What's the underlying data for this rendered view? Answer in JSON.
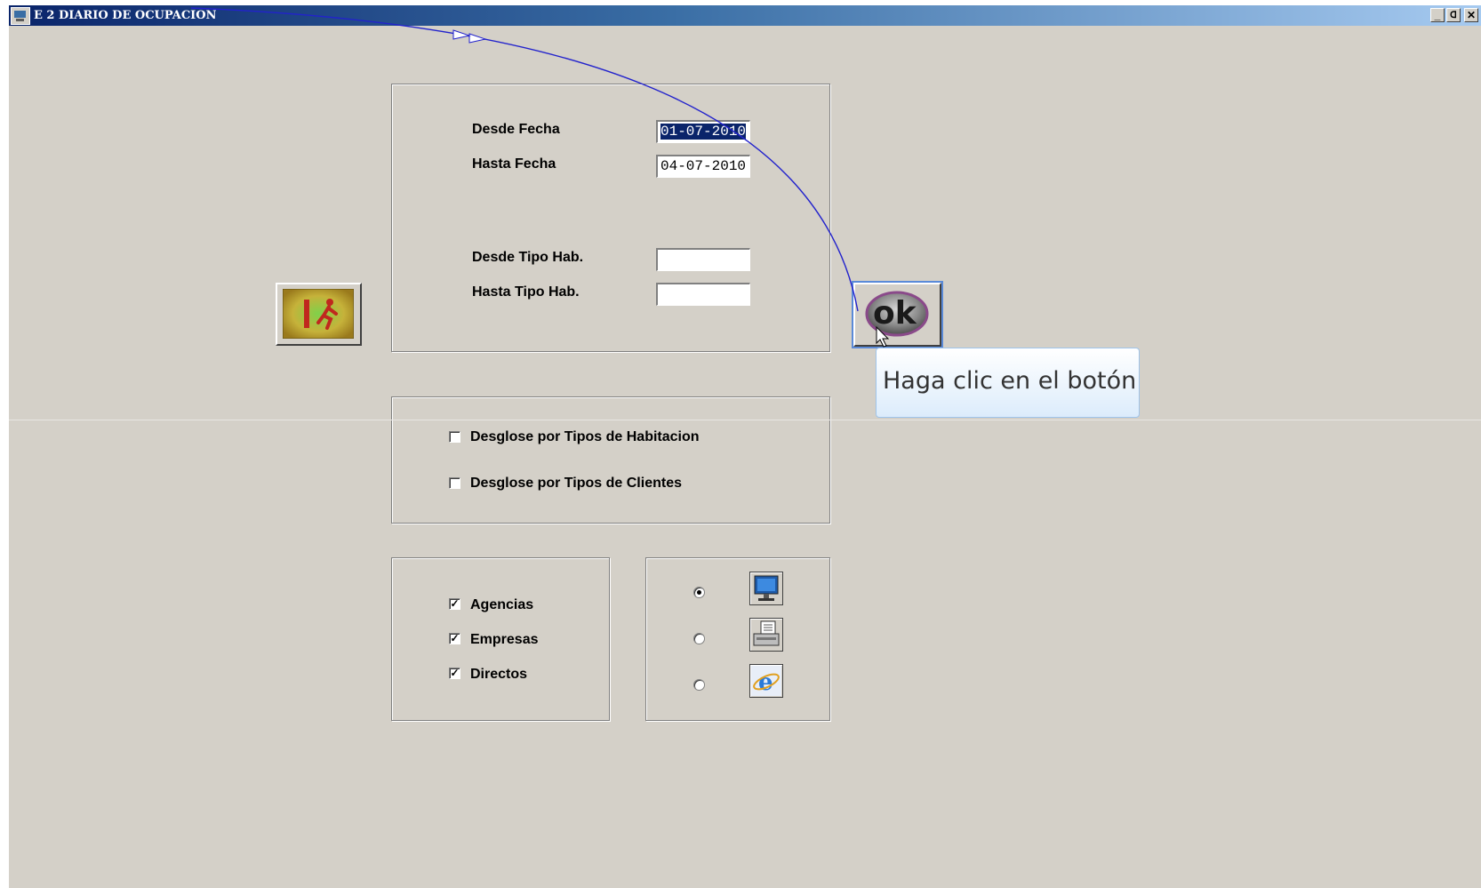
{
  "window": {
    "title": "E 2 DIARIO DE OCUPACION",
    "controls": {
      "minimize": "_",
      "restore": "ᗡ",
      "close": "✕"
    }
  },
  "dates": {
    "desde_label": "Desde Fecha",
    "desde_value": "01-07-2010",
    "hasta_label": "Hasta Fecha",
    "hasta_value": "04-07-2010"
  },
  "room_types": {
    "desde_label": "Desde Tipo Hab.",
    "desde_value": "",
    "hasta_label": "Hasta Tipo Hab.",
    "hasta_value": ""
  },
  "breakdown": {
    "habitacion_label": "Desglose por Tipos de Habitacion",
    "habitacion_checked": false,
    "clientes_label": "Desglose por Tipos de Clientes",
    "clientes_checked": false
  },
  "client_types": [
    {
      "label": "Agencias",
      "checked": true
    },
    {
      "label": "Empresas",
      "checked": true
    },
    {
      "label": "Directos",
      "checked": true
    }
  ],
  "output": [
    {
      "icon": "monitor-icon",
      "selected": true
    },
    {
      "icon": "printer-icon",
      "selected": false
    },
    {
      "icon": "internet-explorer-icon",
      "selected": false
    }
  ],
  "ok_button": {
    "label": "ok"
  },
  "exit_button": {
    "icon": "exit-running-man-icon"
  },
  "tooltip": {
    "text": "Haga clic en el botón"
  },
  "colors": {
    "window_bg": "#d4d0c8",
    "titlebar_start": "#0a246a",
    "selection": "#0a246a",
    "annotation_arrow": "#2222cc"
  },
  "checkmark": "✓"
}
